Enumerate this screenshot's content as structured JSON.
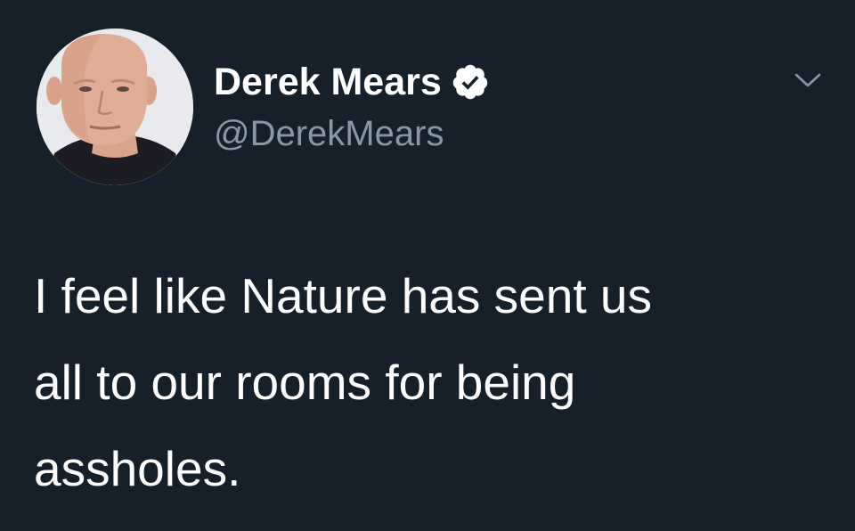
{
  "author": {
    "display_name": "Derek Mears",
    "handle": "@DerekMears",
    "verified": true
  },
  "icons": {
    "verified": "verified-badge-icon",
    "menu": "chevron-down-icon"
  },
  "tweet": {
    "text": "I feel like Nature has sent us\nall to our rooms for being\nassholes."
  },
  "colors": {
    "background": "#15202b",
    "text": "#ffffff",
    "secondary_text": "#8899a6"
  }
}
